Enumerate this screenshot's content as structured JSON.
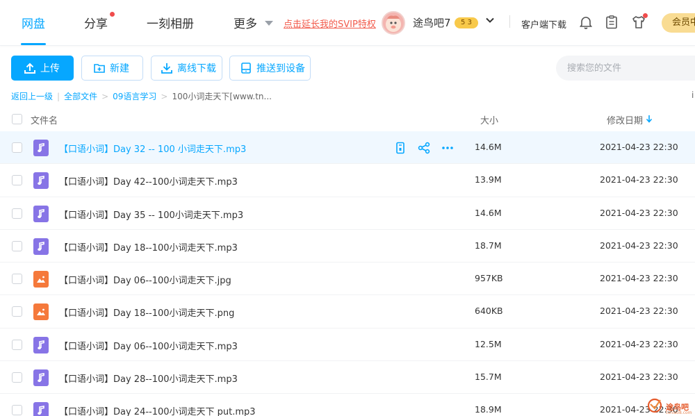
{
  "nav": {
    "items": [
      {
        "label": "网盘",
        "active": true
      },
      {
        "label": "分享",
        "active": false
      },
      {
        "label": "一刻相册",
        "active": false
      },
      {
        "label": "更多",
        "active": false
      }
    ],
    "promo": "点击延长我的SVIP特权",
    "username": "途鸟吧7",
    "level_badge": "5 3",
    "client_download": "客户端下载",
    "vip_button": "会员中"
  },
  "toolbar": {
    "upload": "上传",
    "new": "新建",
    "offline_download": "离线下载",
    "push_to_device": "推送到设备",
    "search_placeholder": "搜索您的文件"
  },
  "breadcrumb": {
    "back": "返回上一级",
    "items": [
      "全部文件",
      "09语言学习"
    ],
    "current": "100小词走天下[www.tn...",
    "edge_char": "i"
  },
  "table": {
    "col_name": "文件名",
    "col_size": "大小",
    "col_date": "修改日期",
    "rows": [
      {
        "name": "【口语小词】Day 32 -- 100 小词走天下.mp3",
        "size": "14.6M",
        "date": "2021-04-23 22:30",
        "type": "audio"
      },
      {
        "name": "【口语小词】Day 42--100小词走天下.mp3",
        "size": "13.9M",
        "date": "2021-04-23 22:30",
        "type": "audio"
      },
      {
        "name": "【口语小词】Day 35 -- 100小词走天下.mp3",
        "size": "14.6M",
        "date": "2021-04-23 22:30",
        "type": "audio"
      },
      {
        "name": "【口语小词】Day 18--100小词走天下.mp3",
        "size": "18.7M",
        "date": "2021-04-23 22:30",
        "type": "audio"
      },
      {
        "name": "【口语小词】Day 06--100小词走天下.jpg",
        "size": "957KB",
        "date": "2021-04-23 22:30",
        "type": "image"
      },
      {
        "name": "【口语小词】Day 18--100小词走天下.png",
        "size": "640KB",
        "date": "2021-04-23 22:30",
        "type": "image"
      },
      {
        "name": "【口语小词】Day 06--100小词走天下.mp3",
        "size": "12.5M",
        "date": "2021-04-23 22:30",
        "type": "audio"
      },
      {
        "name": "【口语小词】Day 28--100小词走天下.mp3",
        "size": "15.7M",
        "date": "2021-04-23 22:30",
        "type": "audio"
      },
      {
        "name": "【口语小词】Day 24--100小词走天下 put.mp3",
        "size": "18.9M",
        "date": "2021-04-23 22:30",
        "type": "audio"
      }
    ]
  },
  "watermark": {
    "text": "途鸟吧",
    "sub": "tuniao8.com"
  },
  "colors": {
    "accent": "#06a7ff",
    "audio_icon": "#8774e6",
    "image_icon": "#f5793b",
    "promo": "#f25b4c",
    "vip": "#f9dc93"
  }
}
